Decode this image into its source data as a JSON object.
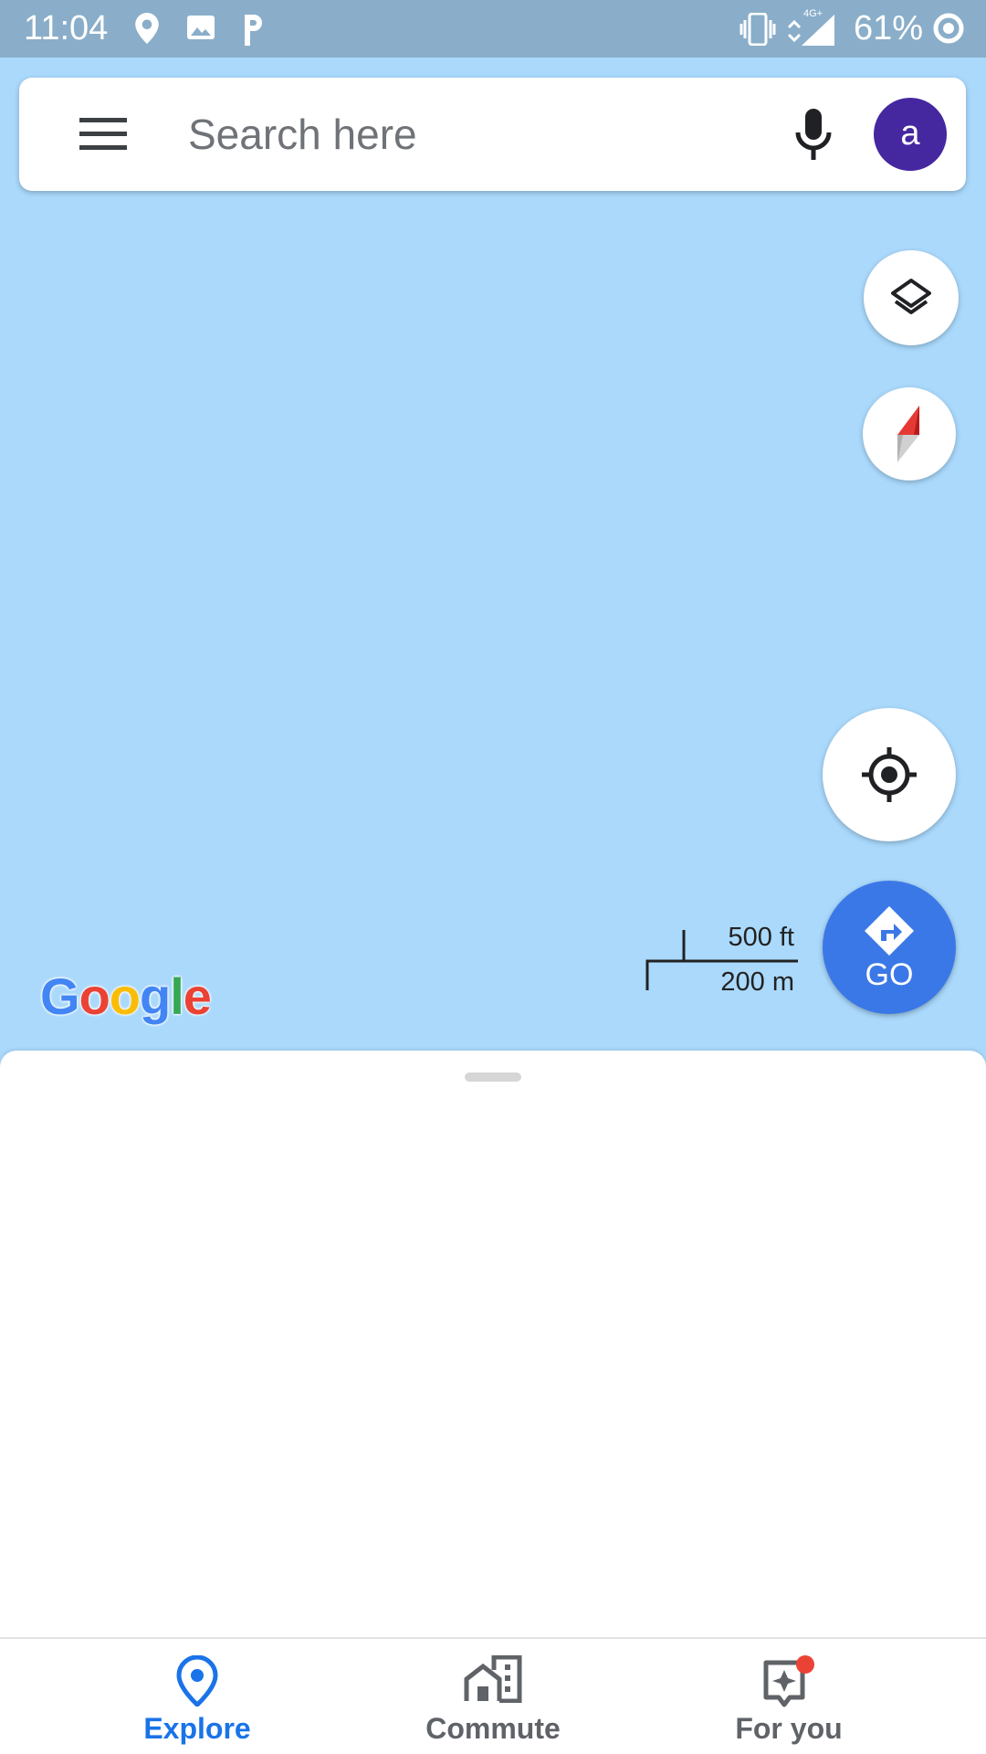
{
  "status_bar": {
    "time": "11:04",
    "battery_percent": "61%",
    "network": "4G+",
    "icons": [
      "location-pin-icon",
      "image-icon",
      "parking-icon",
      "vibrate-icon",
      "signal-icon",
      "sync-icon"
    ]
  },
  "search": {
    "placeholder": "Search here",
    "value": "",
    "avatar_letter": "a",
    "avatar_color": "#4527a0"
  },
  "map": {
    "background_color": "#aad9fc",
    "go_label": "GO",
    "scale_imperial": "500 ft",
    "scale_metric": "200 m",
    "logo_text": "Google"
  },
  "bottom_nav": {
    "tabs": [
      {
        "label": "Explore",
        "icon": "explore-pin-icon",
        "active": true
      },
      {
        "label": "Commute",
        "icon": "commute-icon",
        "active": false
      },
      {
        "label": "For you",
        "icon": "for-you-icon",
        "active": false,
        "badge": true
      }
    ],
    "active_color": "#1a73e8"
  }
}
